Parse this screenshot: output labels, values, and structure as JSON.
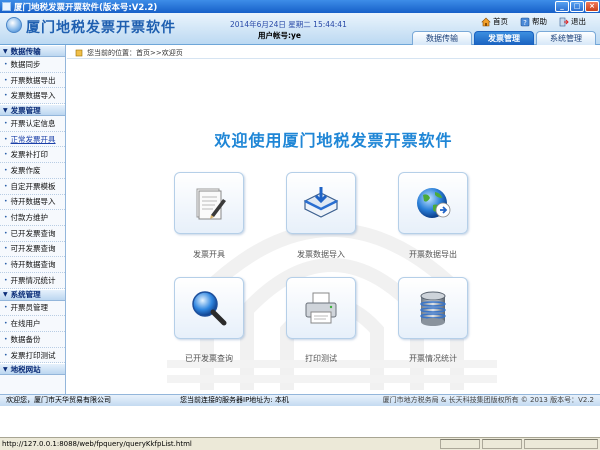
{
  "window": {
    "title": "厦门地税发票开票软件(版本号:V2.2)"
  },
  "header": {
    "app_title": "厦门地税发票开票软件",
    "datetime": "2014年6月24日  星期二  15:44:41",
    "account": "用户帐号:ye",
    "links": {
      "home": "首页",
      "help": "帮助",
      "exit": "退出"
    },
    "tabs": [
      {
        "label": "数据传输",
        "active": false
      },
      {
        "label": "发票管理",
        "active": true
      },
      {
        "label": "系统管理",
        "active": false
      }
    ]
  },
  "sidebar": {
    "groups": [
      {
        "title": "数据传输",
        "items": [
          "数据同步",
          "开票数据导出",
          "发票数据导入"
        ]
      },
      {
        "title": "发票管理",
        "items": [
          "开票认定信息",
          "正常发票开具",
          "发票补打印",
          "发票作废",
          "自定开票模板",
          "待开数据导入",
          "付款方维护",
          "已开发票查询",
          "可开发票查询",
          "待开数据查询",
          "开票情况统计"
        ]
      },
      {
        "title": "系统管理",
        "items": [
          "开票员管理",
          "在线用户",
          "数据备份",
          "发票打印测试"
        ]
      },
      {
        "title": "地税网站",
        "items": []
      }
    ],
    "active_item": "正常发票开具"
  },
  "main": {
    "breadcrumb": "您当前的位置：首页>>欢迎页",
    "welcome": "欢迎使用厦门地税发票开票软件",
    "tiles": [
      {
        "label": "发票开具",
        "icon": "invoice-pen-icon"
      },
      {
        "label": "发票数据导入",
        "icon": "data-import-icon"
      },
      {
        "label": "开票数据导出",
        "icon": "globe-export-icon"
      },
      {
        "label": "已开发票查询",
        "icon": "magnifier-icon"
      },
      {
        "label": "打印测试",
        "icon": "printer-icon"
      },
      {
        "label": "开票情况统计",
        "icon": "database-icon"
      }
    ]
  },
  "status": {
    "company": "欢迎您，厦门市天华贸易有限公司",
    "server": "您当前连接的服务器IP地址为: 本机",
    "copyright": "厦门市地方税务局 & 长天科技集团版权所有 © 2013  版本号：V2.2",
    "url": "http://127.0.0.1:8088/web/fpquery/queryKkfpList.html"
  },
  "colors": {
    "accent": "#1f86d6",
    "tab_active": "#1a62c0",
    "header_bg": "#bcd9f2"
  }
}
